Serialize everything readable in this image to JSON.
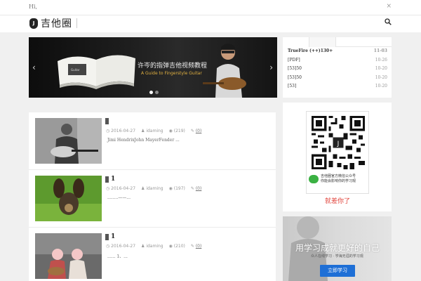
{
  "topbar": {
    "greeting": "Hi,",
    "close": "×"
  },
  "header": {
    "logo_mark": "J",
    "logo_text": "吉他圈"
  },
  "slider": {
    "title": "许岑的指弹吉他视频教程",
    "subtitle": "A Guide to Fingerstyle Guitar",
    "prev": "‹",
    "next": "›"
  },
  "sidelist": {
    "items": [
      {
        "title": "TrueFire (++)130+",
        "date": "11-03",
        "bold": true
      },
      {
        "title": "[PDF]",
        "date": "10-26"
      },
      {
        "title": "[53]50",
        "date": "10-20"
      },
      {
        "title": "[53]50",
        "date": "10-20"
      },
      {
        "title": "[53]",
        "date": "10-20"
      }
    ]
  },
  "posts": [
    {
      "title": "",
      "date": "2016-04-27",
      "author": "idaming",
      "views": "(219)",
      "comments": "(0)",
      "excerpt": "Jimi HendrixJohn MayerFender ..."
    },
    {
      "title": "1",
      "date": "2016-04-27",
      "author": "idaming",
      "views": "(197)",
      "comments": "(0)",
      "excerpt": "........——..."
    },
    {
      "title": "1",
      "date": "2016-04-27",
      "author": "idaming",
      "views": "(210)",
      "comments": "(0)",
      "excerpt": "...... 1、..."
    }
  ],
  "qr": {
    "wechat_line1": "吉他圈官方微信公众号",
    "wechat_line2": "你能会影响你的学习观",
    "miss_text": "就差你了"
  },
  "ad": {
    "title": "用学习成就更好的自己",
    "subtitle": "众人在线学习 · 学海无涯的学习观",
    "button": "立即学习"
  },
  "colors": {
    "accent_red": "#e2453d",
    "button_blue": "#1e6fd6",
    "wechat_green": "#3bb143"
  }
}
